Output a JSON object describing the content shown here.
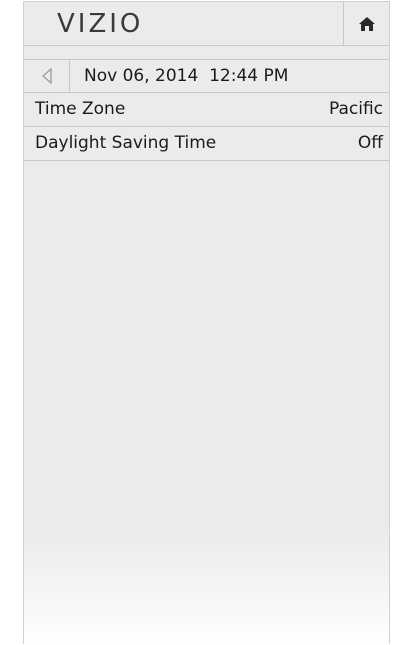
{
  "header": {
    "logo_text": "VIZIO",
    "home_icon": "home-icon"
  },
  "subbar": {
    "back_icon": "back-triangle-icon",
    "datetime": "Nov 06, 2014  12:44 PM"
  },
  "settings": [
    {
      "label": "Time Zone",
      "value": "Pacific"
    },
    {
      "label": "Daylight Saving Time",
      "value": "Off"
    }
  ],
  "colors": {
    "background": "#ebebeb",
    "divider": "#c8c8c8",
    "text": "#1a1a1a"
  }
}
